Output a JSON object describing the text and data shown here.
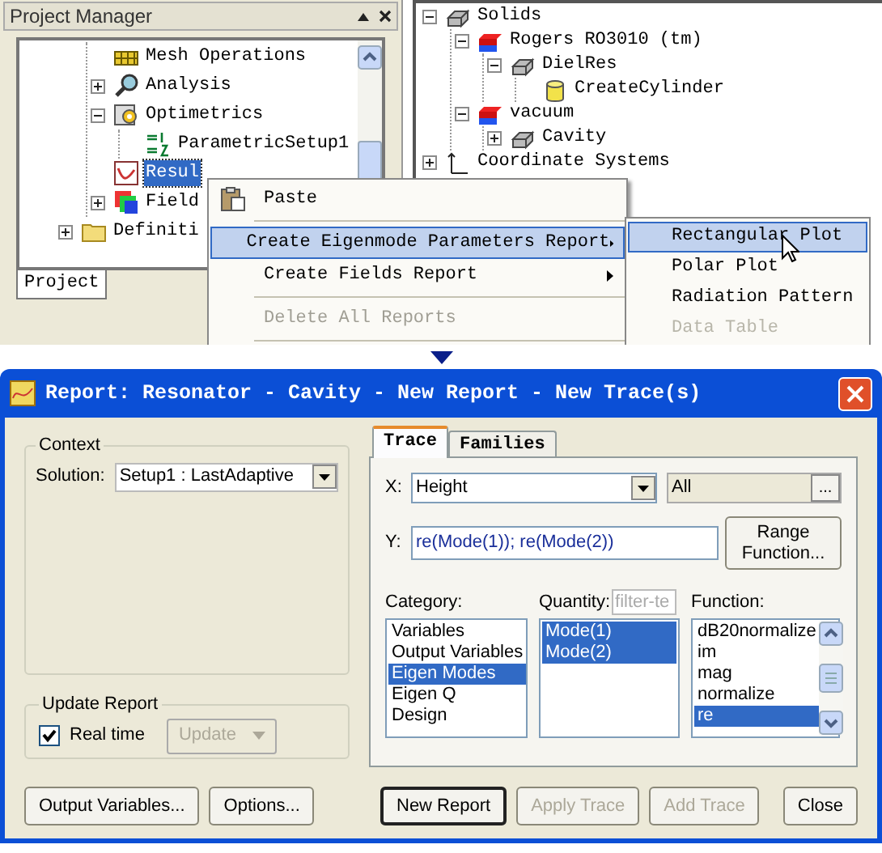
{
  "project_manager": {
    "title": "Project Manager",
    "tab": "Project",
    "tree": [
      {
        "children": [
          {
            "label": "Mesh Operations",
            "kind": "mesh",
            "selected": false
          },
          {
            "label": "Analysis",
            "kind": "analysis",
            "selected": false,
            "expanded": false
          },
          {
            "label": "Optimetrics",
            "kind": "optimetrics",
            "selected": false,
            "expanded": true,
            "children": [
              {
                "label": "ParametricSetup1",
                "kind": "parametric",
                "selected": false
              }
            ]
          },
          {
            "label": "Resul",
            "kind": "results",
            "selected": true
          },
          {
            "label": "Field",
            "kind": "fields",
            "selected": false,
            "expanded": false
          }
        ]
      },
      {
        "label": "Definiti",
        "kind": "folder",
        "selected": false,
        "expanded": false
      }
    ]
  },
  "model_tree": [
    {
      "label": "Solids",
      "kind": "solid",
      "selected": false,
      "expanded": true,
      "children": [
        {
          "label": "Rogers RO3010 (tm)",
          "kind": "material",
          "selected": false,
          "expanded": true,
          "children": [
            {
              "label": "DielRes",
              "kind": "solid",
              "selected": false,
              "expanded": true,
              "children": [
                {
                  "label": "CreateCylinder",
                  "kind": "cylinder",
                  "selected": false
                }
              ]
            }
          ]
        },
        {
          "label": "vacuum",
          "kind": "material",
          "selected": false,
          "expanded": true,
          "children": [
            {
              "label": "Cavity",
              "kind": "solid",
              "selected": false,
              "expanded": false
            }
          ]
        }
      ]
    },
    {
      "label": "Coordinate Systems",
      "kind": "coordinates",
      "selected": false,
      "expanded": false
    }
  ],
  "context_menu": [
    {
      "kind": "item",
      "label": "Paste",
      "selected": false,
      "disabled": false,
      "submenu": false
    },
    {
      "kind": "separator"
    },
    {
      "kind": "item",
      "label": "Create Eigenmode Parameters Report",
      "selected": true,
      "disabled": false,
      "submenu": true
    },
    {
      "kind": "item",
      "label": "Create Fields Report",
      "selected": false,
      "disabled": false,
      "submenu": true
    },
    {
      "kind": "separator"
    },
    {
      "kind": "item",
      "label": "Delete All Reports",
      "selected": false,
      "disabled": true,
      "submenu": false
    },
    {
      "kind": "separator"
    }
  ],
  "submenu": [
    {
      "label": "Rectangular Plot",
      "selected": true,
      "disabled": false
    },
    {
      "label": "Polar Plot",
      "selected": false,
      "disabled": false
    },
    {
      "label": "Radiation Pattern",
      "selected": false,
      "disabled": false
    },
    {
      "label": "Data Table",
      "selected": false,
      "disabled": true
    }
  ],
  "dialog": {
    "title": "Report: Resonator - Cavity - New Report - New Trace(s)",
    "context": {
      "legend": "Context",
      "solution_label": "Solution:",
      "solution": "Setup1 : LastAdaptive"
    },
    "update": {
      "legend": "Update Report",
      "real_time_label": "Real time",
      "real_time": true,
      "button": "Update",
      "button_disabled": true
    },
    "tabs": [
      {
        "label": "Trace",
        "selected": true
      },
      {
        "label": "Families",
        "selected": false
      }
    ],
    "x_label": "X:",
    "x_value": "Height",
    "x_range": "All",
    "x_range_button": "...",
    "y_label": "Y:",
    "y_value": "re(Mode(1)); re(Mode(2))",
    "range_button": "Range Function...",
    "category": {
      "label": "Category:",
      "items": [
        {
          "label": "Variables",
          "selected": false
        },
        {
          "label": "Output Variables",
          "selected": false
        },
        {
          "label": "Eigen Modes",
          "selected": true
        },
        {
          "label": "Eigen Q",
          "selected": false
        },
        {
          "label": "Design",
          "selected": false
        }
      ]
    },
    "quantity": {
      "label": "Quantity:",
      "filter_placeholder": "filter-te",
      "items": [
        {
          "label": "Mode(1)",
          "selected": true
        },
        {
          "label": "Mode(2)",
          "selected": true
        }
      ]
    },
    "function": {
      "label": "Function:",
      "items": [
        {
          "label": "dB20normalize",
          "selected": false
        },
        {
          "label": "im",
          "selected": false
        },
        {
          "label": "mag",
          "selected": false
        },
        {
          "label": "normalize",
          "selected": false
        },
        {
          "label": "re",
          "selected": true
        }
      ]
    },
    "left_buttons": [
      {
        "label": "Output Variables...",
        "disabled": false,
        "default": false
      },
      {
        "label": "Options...",
        "disabled": false,
        "default": false
      }
    ],
    "right_buttons": [
      {
        "label": "New Report",
        "disabled": false,
        "default": true
      },
      {
        "label": "Apply Trace",
        "disabled": true,
        "default": false
      },
      {
        "label": "Add Trace",
        "disabled": true,
        "default": false
      },
      {
        "label": "Close",
        "disabled": false,
        "default": false
      }
    ]
  }
}
